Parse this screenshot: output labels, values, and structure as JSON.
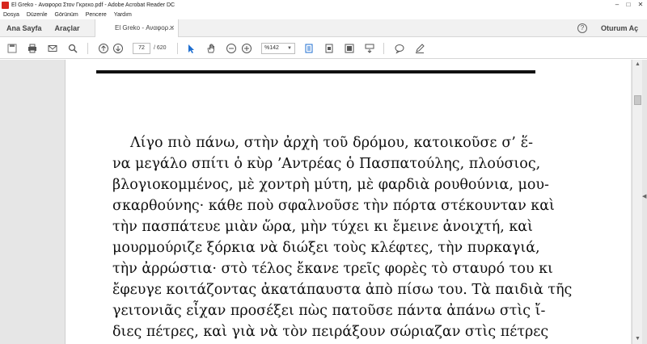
{
  "window": {
    "title": "El Greko - Αναφορα Στον Γκρεκο.pdf - Adobe Acrobat Reader DC"
  },
  "menu": [
    "Dosya",
    "Düzenle",
    "Görünüm",
    "Pencere",
    "Yardım"
  ],
  "tabs": {
    "home": "Ana Sayfa",
    "tools": "Araçlar",
    "document": "El Greko - Αναφορ...",
    "signin": "Oturum Aç"
  },
  "toolbar": {
    "page_current": "72",
    "page_total": "/ 620",
    "zoom": "%142"
  },
  "document": {
    "lines": [
      "Λίγο πιὸ πάνω, στὴν ἀρχὴ τοῦ δρόμου, κατοικοῦσε σ’ ἕ-",
      "να μεγάλο σπίτι ὁ κὺρ ’Αντρέας ὁ Πασπατούλης, πλούσιος,",
      "βλογιοκομμένος, μὲ χοντρὴ μύτη, μὲ φαρδιὰ ρουθούνια, μου-",
      "σκαρθούνης· κάθε ποὺ σφαλνοῦσε τὴν πόρτα στέκουνταν καὶ",
      "τὴν πασπάτευε μιὰν ὥρα, μὴν τύχει κι ἔμεινε ἀνοιχτή, καὶ",
      "μουρμούριζε ξόρκια νὰ διώξει τοὺς κλέφτες, τὴν πυρκαγιά,",
      "τὴν ἀρρώστια· στὸ τέλος ἔκανε τρεῖς φορὲς τὸ σταυρό του κι",
      "ἔφευγε κοιτάζοντας ἀκατάπαυστα ἀπὸ πίσω του. Τὰ παιδιὰ τῆς",
      "γειτονιᾶς εἶχαν προσέξει πὼς πατοῦσε πάντα ἀπάνω στὶς ἴ-",
      "διες πέτρες, καὶ γιὰ νὰ τὸν πειράξουν σώριαζαν στὶς πέτρες"
    ]
  }
}
